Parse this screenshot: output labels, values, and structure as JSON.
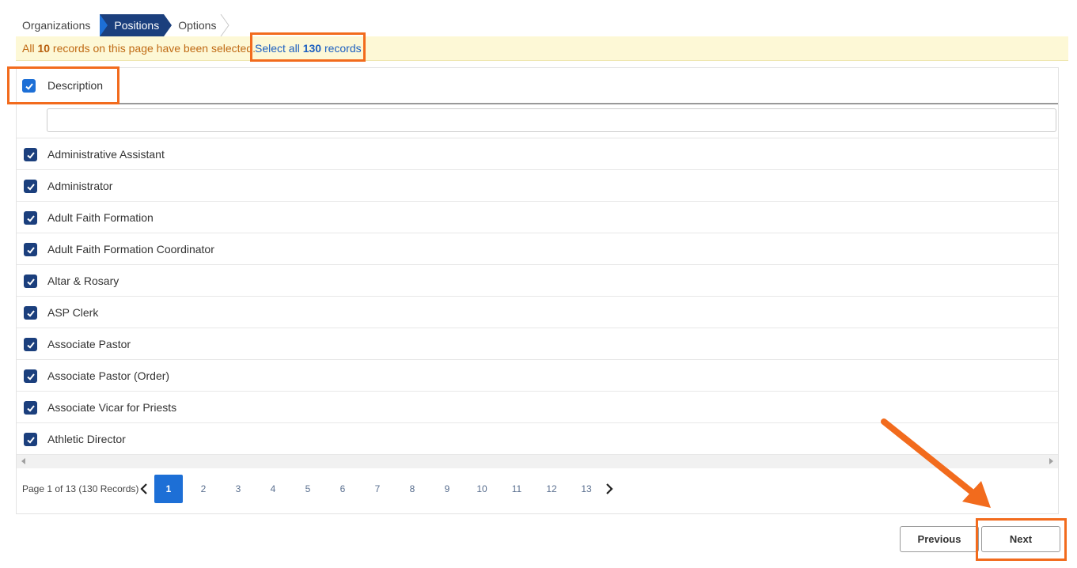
{
  "wizard": {
    "steps": [
      {
        "label": "Organizations"
      },
      {
        "label": "Positions"
      },
      {
        "label": "Options"
      }
    ]
  },
  "banner": {
    "prefix": "All ",
    "page_count": "10",
    "suffix": " records on this page have been selected.",
    "select_all_prefix": "Select all ",
    "total_count": "130",
    "select_all_suffix": " records"
  },
  "table": {
    "header_label": "Description",
    "filter_value": "",
    "rows": [
      {
        "label": "Administrative Assistant",
        "checked": true
      },
      {
        "label": "Administrator",
        "checked": true
      },
      {
        "label": "Adult Faith Formation",
        "checked": true
      },
      {
        "label": "Adult Faith Formation Coordinator",
        "checked": true
      },
      {
        "label": "Altar & Rosary",
        "checked": true
      },
      {
        "label": "ASP Clerk",
        "checked": true
      },
      {
        "label": "Associate Pastor",
        "checked": true
      },
      {
        "label": "Associate Pastor (Order)",
        "checked": true
      },
      {
        "label": "Associate Vicar for Priests",
        "checked": true
      },
      {
        "label": "Athletic Director",
        "checked": true
      }
    ]
  },
  "pager": {
    "info": "Page 1 of 13 (130 Records)",
    "pages": [
      "1",
      "2",
      "3",
      "4",
      "5",
      "6",
      "7",
      "8",
      "9",
      "10",
      "11",
      "12",
      "13"
    ],
    "current": "1"
  },
  "buttons": {
    "previous": "Previous",
    "next": "Next"
  },
  "colors": {
    "accent": "#1d6fd6",
    "navy": "#1b3f7d",
    "highlight": "#f26b1d",
    "banner_bg": "#fdf8d6"
  }
}
